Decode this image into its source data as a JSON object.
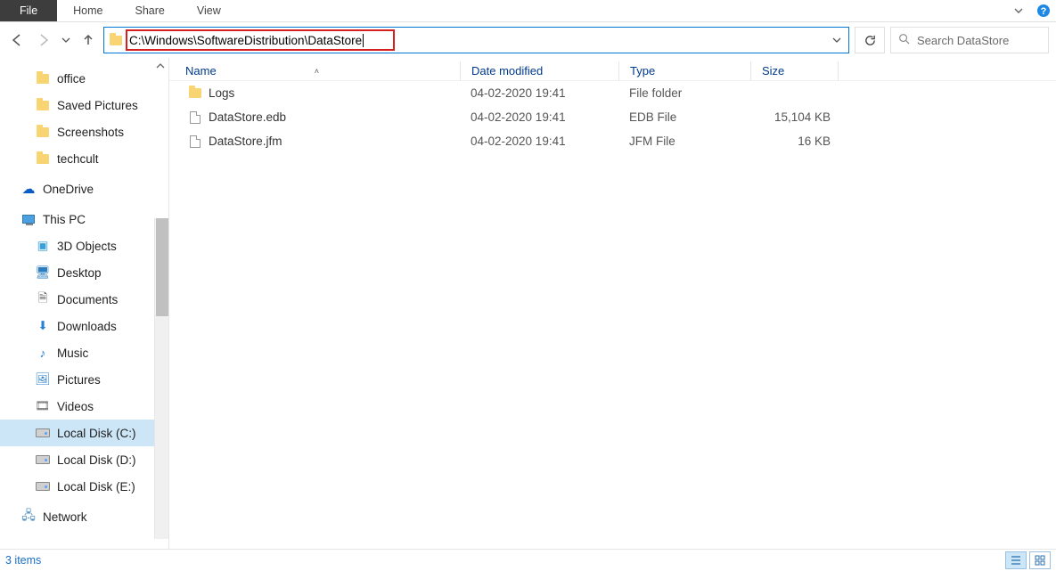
{
  "ribbon": {
    "file": "File",
    "tabs": [
      "Home",
      "Share",
      "View"
    ]
  },
  "nav": {
    "address": "C:\\Windows\\SoftwareDistribution\\DataStore",
    "search_placeholder": "Search DataStore"
  },
  "sidebar": {
    "quick_access": [
      {
        "label": "office",
        "icon": "folder"
      },
      {
        "label": "Saved Pictures",
        "icon": "folder"
      },
      {
        "label": "Screenshots",
        "icon": "folder"
      },
      {
        "label": "techcult",
        "icon": "folder"
      }
    ],
    "onedrive": {
      "label": "OneDrive"
    },
    "this_pc": {
      "label": "This PC",
      "items": [
        {
          "label": "3D Objects",
          "icon": "3d"
        },
        {
          "label": "Desktop",
          "icon": "desktop"
        },
        {
          "label": "Documents",
          "icon": "documents"
        },
        {
          "label": "Downloads",
          "icon": "downloads"
        },
        {
          "label": "Music",
          "icon": "music"
        },
        {
          "label": "Pictures",
          "icon": "pictures"
        },
        {
          "label": "Videos",
          "icon": "videos"
        },
        {
          "label": "Local Disk (C:)",
          "icon": "drive",
          "selected": true
        },
        {
          "label": "Local Disk (D:)",
          "icon": "drive"
        },
        {
          "label": "Local Disk (E:)",
          "icon": "drive"
        }
      ]
    },
    "network": {
      "label": "Network"
    }
  },
  "columns": {
    "name": "Name",
    "date": "Date modified",
    "type": "Type",
    "size": "Size"
  },
  "rows": [
    {
      "name": "Logs",
      "date": "04-02-2020 19:41",
      "type": "File folder",
      "size": "",
      "icon": "folder"
    },
    {
      "name": "DataStore.edb",
      "date": "04-02-2020 19:41",
      "type": "EDB File",
      "size": "15,104 KB",
      "icon": "file"
    },
    {
      "name": "DataStore.jfm",
      "date": "04-02-2020 19:41",
      "type": "JFM File",
      "size": "16 KB",
      "icon": "file"
    }
  ],
  "status": {
    "count": "3 items"
  }
}
